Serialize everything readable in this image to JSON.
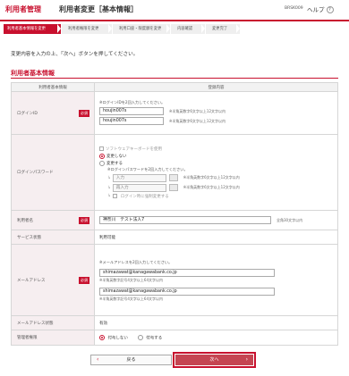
{
  "header": {
    "brand": "利用者管理",
    "title": "利用者変更［基本情報］",
    "screen_id": "BRSK009",
    "help_label": "ヘルプ",
    "help_icon": "?"
  },
  "steps": [
    "利用者基本情報を変更",
    "利用者権限を変更",
    "利用口座・限度額を変更",
    "内容確認",
    "変更完了"
  ],
  "instruction": "変更内容を入力の上、「次へ」ボタンを押してください。",
  "section_title": "利用者基本情報",
  "table": {
    "head_label": "利用者基本情報",
    "head_value": "登録内容",
    "required_label": "必須",
    "login_id": {
      "label": "ログインID",
      "note": "※ログインIDを2回入力してください。",
      "value1": "houjin007s",
      "value2": "houjin007s",
      "hint1": "※半角英数字6文字以上12文字以内",
      "hint2": "※半角英数字6文字以上12文字以内"
    },
    "password": {
      "label": "ログインパスワード",
      "software_keyboard": "ソフトウェアキーボードを使用",
      "no_change": "変更しない",
      "change": "変更する",
      "change_note": "※ログインパスワードを2回入力してください。",
      "input_label": "入力",
      "reinput_label": "再入力",
      "hint1": "※半角英数字6文字以上12文字以内",
      "hint2": "※半角英数字6文字以上12文字以内",
      "force_change": "ログイン時に強制変更する"
    },
    "user_name": {
      "label": "利用者名",
      "value": "神奈川　テスト法人7",
      "hint": "全角30文字以内"
    },
    "service_status": {
      "label": "サービス状態",
      "value": "利用可能"
    },
    "email": {
      "label": "メールアドレス",
      "note": "※メールアドレスを2回入力してください。",
      "value1": "shimazawat@kanagawabank.co.jp",
      "value2": "shimazawat@kanagawabank.co.jp",
      "hint1": "※半角英数字記号4文字以上64文字以内",
      "hint2": "※半角英数字記号4文字以上64文字以内"
    },
    "email_status": {
      "label": "メールアドレス状態",
      "value": "有効"
    },
    "admin_authority": {
      "label": "管理者権限",
      "option_no": "付与しない",
      "option_yes": "付与する"
    }
  },
  "buttons": {
    "back": "戻る",
    "next": "次へ",
    "back_icon": "‹",
    "next_icon": "›"
  }
}
